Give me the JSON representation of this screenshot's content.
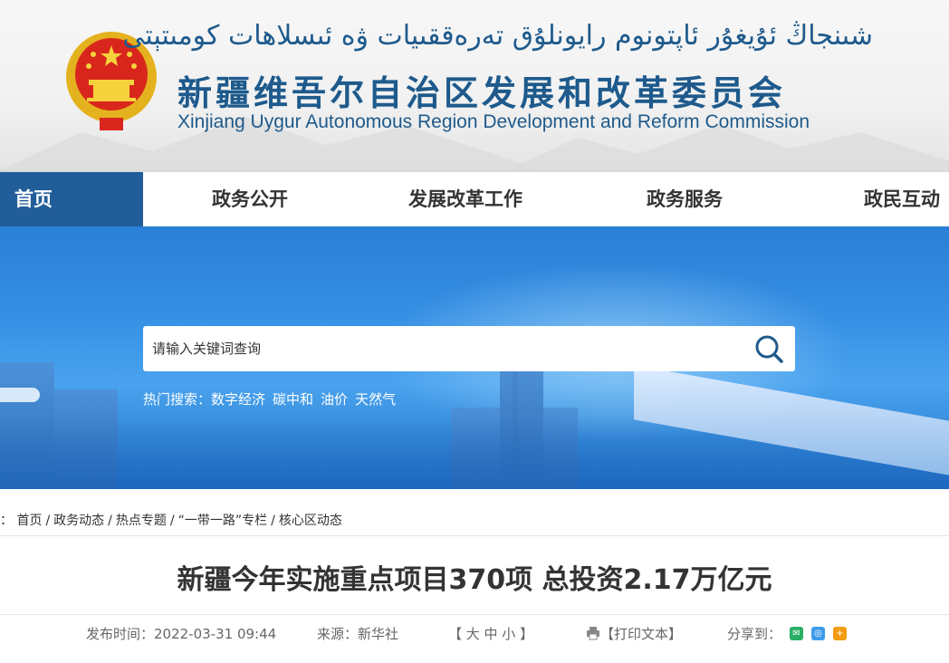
{
  "header": {
    "uyghur_title": "شىنجاڭ ئۇيغۇر ئاپتونوم رايونلۇق تەرەققىيات ۋە ئىسلاھات كومىتېتى",
    "chinese_title": "新疆维吾尔自治区发展和改革委员会",
    "english_title": "Xinjiang Uygur Autonomous Region Development and Reform Commission"
  },
  "nav": {
    "items": [
      {
        "label": "首页"
      },
      {
        "label": "政务公开"
      },
      {
        "label": "发展改革工作"
      },
      {
        "label": "政务服务"
      },
      {
        "label": "政民互动"
      }
    ]
  },
  "search": {
    "placeholder": "请输入关键词查询",
    "hot_label": "热门搜索：",
    "hot_terms": [
      "数字经济",
      "碳中和",
      "油价",
      "天然气"
    ]
  },
  "breadcrumb": {
    "prefix": "：",
    "items": [
      "首页",
      "政务动态",
      "热点专题",
      "“一带一路”专栏",
      "核心区动态"
    ],
    "separator": "/"
  },
  "article": {
    "title": "新疆今年实施重点项目370项 总投资2.17万亿元",
    "publish_time_label": "发布时间：2022-03-31 09:44",
    "source_label": "来源：新华社",
    "font_size_label": "【 大  中  小 】",
    "print_label": "【打印文本】",
    "share_label": "分享到："
  },
  "colors": {
    "brand_blue": "#215d99",
    "title_blue": "#1e5a8c",
    "wechat_green": "#2aae67",
    "share_blue": "#3d9be9",
    "share_orange": "#f39c12"
  }
}
